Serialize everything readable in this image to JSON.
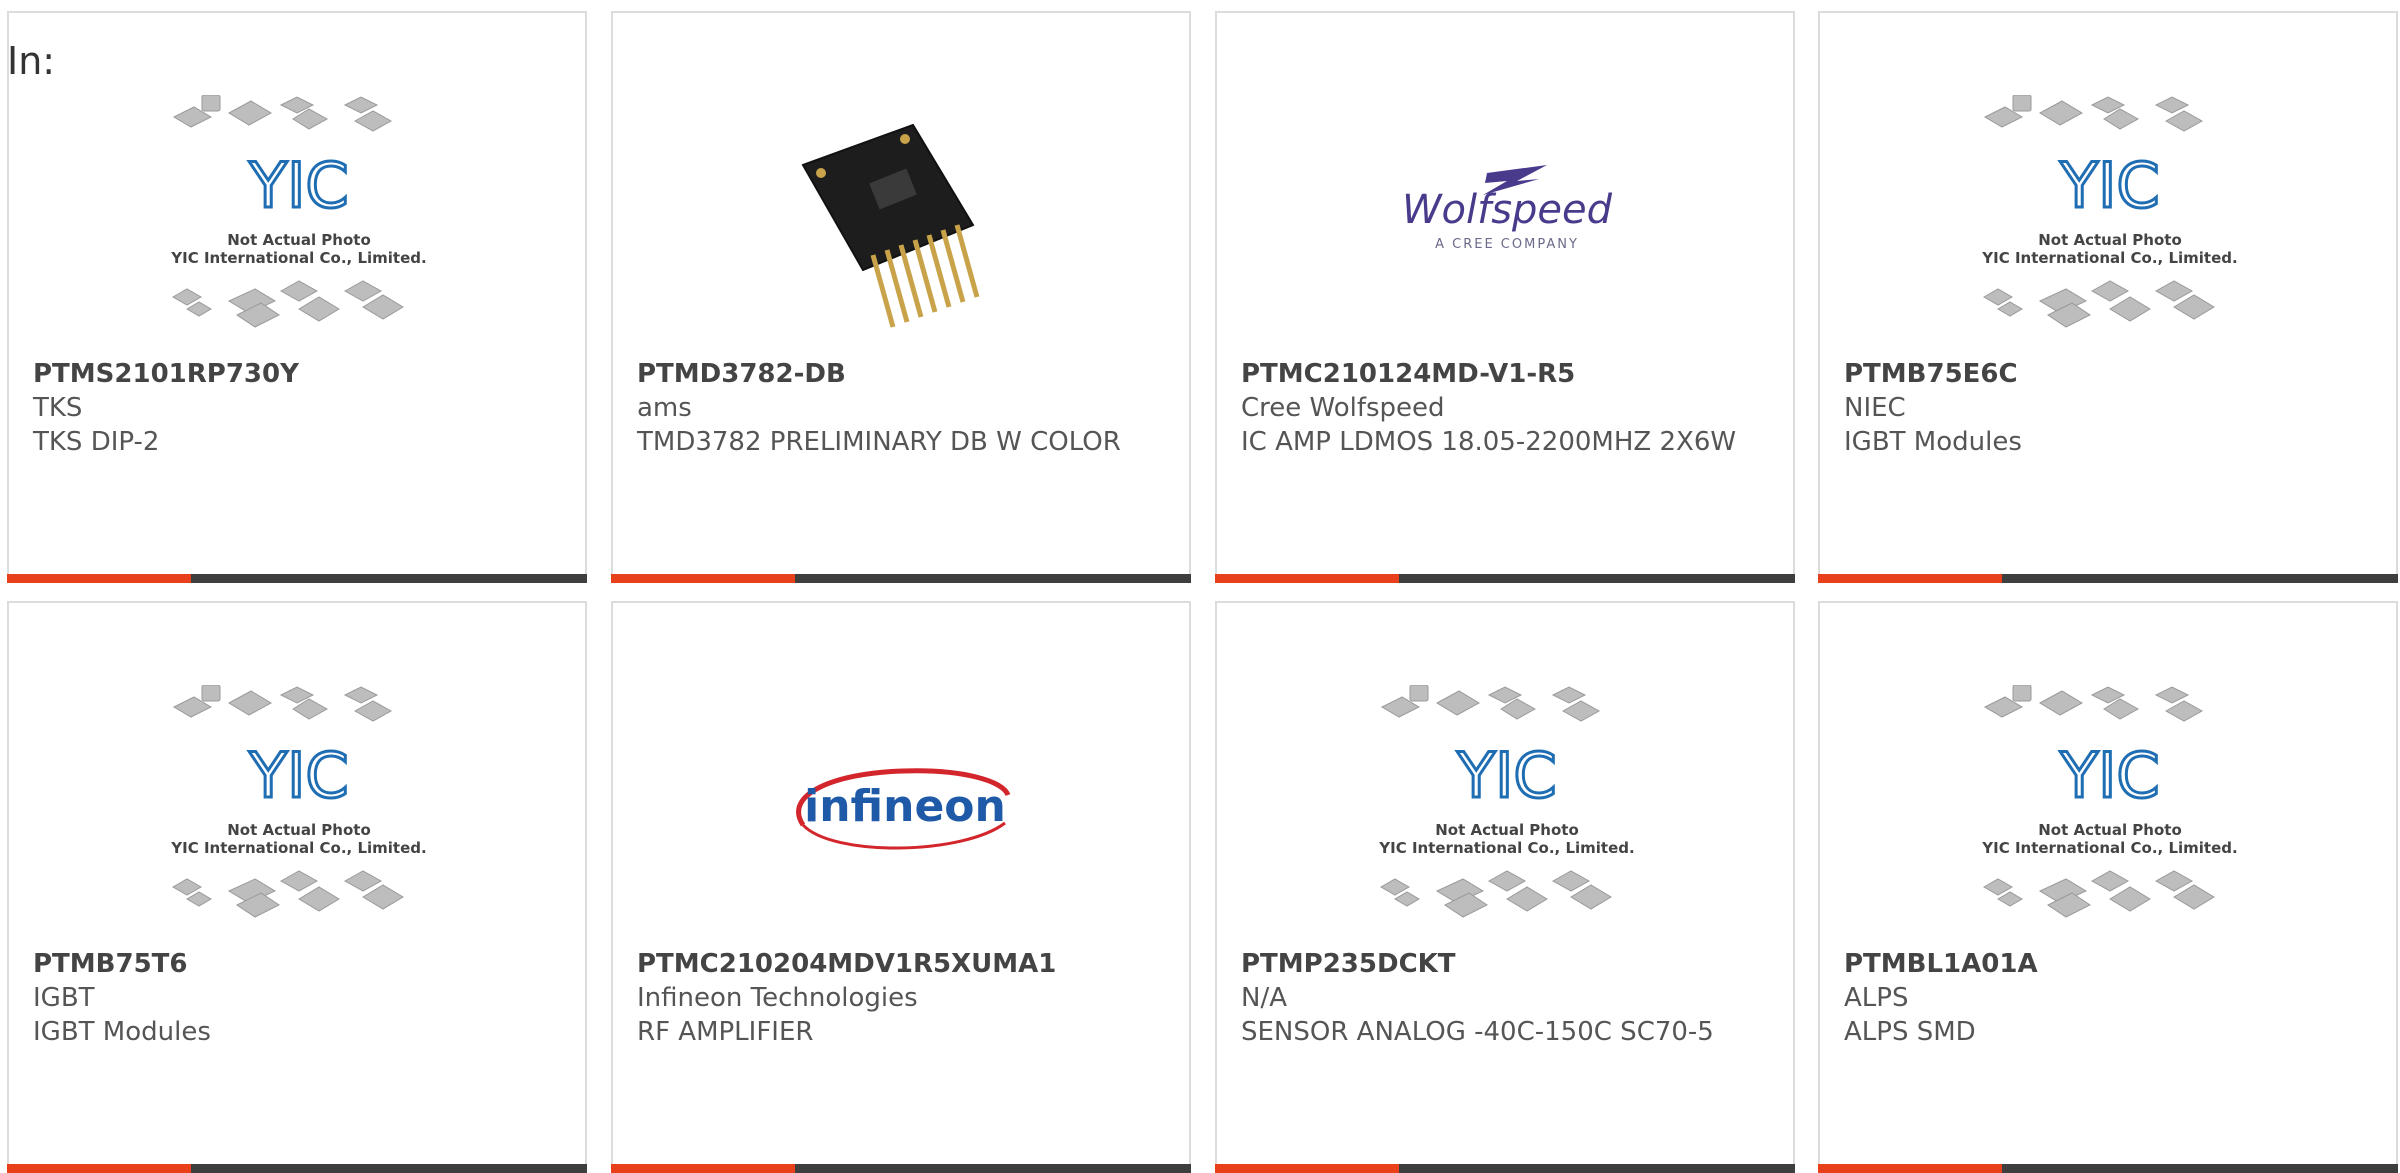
{
  "header": {
    "in_label": "In:"
  },
  "colors": {
    "accent": "#e8401a",
    "bar": "#3e3e3e",
    "border": "#dcdcdc",
    "yic_blue": "#1f6db3"
  },
  "placeholder": {
    "line1": "Not Actual Photo",
    "line2": "YIC International Co., Limited.",
    "logo_text": "YIC"
  },
  "logos": {
    "wolfspeed_name": "Wolfspeed",
    "wolfspeed_tag": "A CREE COMPANY",
    "infineon_name": "infineon"
  },
  "products": [
    {
      "part_number": "PTMS2101RP730Y",
      "manufacturer": "TKS",
      "description": "TKS DIP-2",
      "image": "placeholder-icon"
    },
    {
      "part_number": "PTMD3782-DB",
      "manufacturer": "ams",
      "description": "TMD3782 PRELIMINARY DB W COLOR",
      "image": "pcb-board-icon"
    },
    {
      "part_number": "PTMC210124MD-V1-R5",
      "manufacturer": "Cree Wolfspeed",
      "description": "IC AMP LDMOS 18.05-2200MHZ 2X6W",
      "image": "wolfspeed-logo"
    },
    {
      "part_number": "PTMB75E6C",
      "manufacturer": "NIEC",
      "description": "IGBT Modules",
      "image": "placeholder-icon"
    },
    {
      "part_number": "PTMB75T6",
      "manufacturer": "IGBT",
      "description": "IGBT Modules",
      "image": "placeholder-icon"
    },
    {
      "part_number": "PTMC210204MDV1R5XUMA1",
      "manufacturer": "Infineon Technologies",
      "description": "RF AMPLIFIER",
      "image": "infineon-logo"
    },
    {
      "part_number": "PTMP235DCKT",
      "manufacturer": "N/A",
      "description": "SENSOR ANALOG -40C-150C SC70-5",
      "image": "placeholder-icon"
    },
    {
      "part_number": "PTMBL1A01A",
      "manufacturer": "ALPS",
      "description": "ALPS SMD",
      "image": "placeholder-icon"
    }
  ]
}
